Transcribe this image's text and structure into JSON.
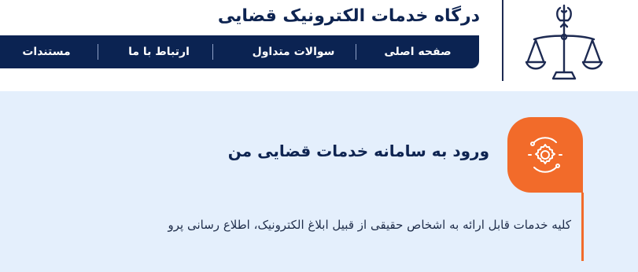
{
  "header": {
    "site_title": "درگاه خدمات الکترونیک قضایی",
    "logo_icon": "judiciary-scales-emblem-icon"
  },
  "nav": {
    "items": [
      {
        "label": "صفحه اصلی"
      },
      {
        "label": "سوالات متداول"
      },
      {
        "label": "ارتباط با ما"
      },
      {
        "label": "مستندات"
      }
    ]
  },
  "section": {
    "icon": "gear-circuit-icon",
    "title": "ورود به سامانه خدمات قضایی من",
    "description": "کلیه خدمات قابل ارائه به اشخاص حقیقی از قبیل ابلاغ الکترونیک، اطلاع رسانی پرو"
  },
  "colors": {
    "navy": "#0b2352",
    "accent_orange": "#f26b2a",
    "background_blue": "#e4effc",
    "header_white": "#ffffff"
  }
}
